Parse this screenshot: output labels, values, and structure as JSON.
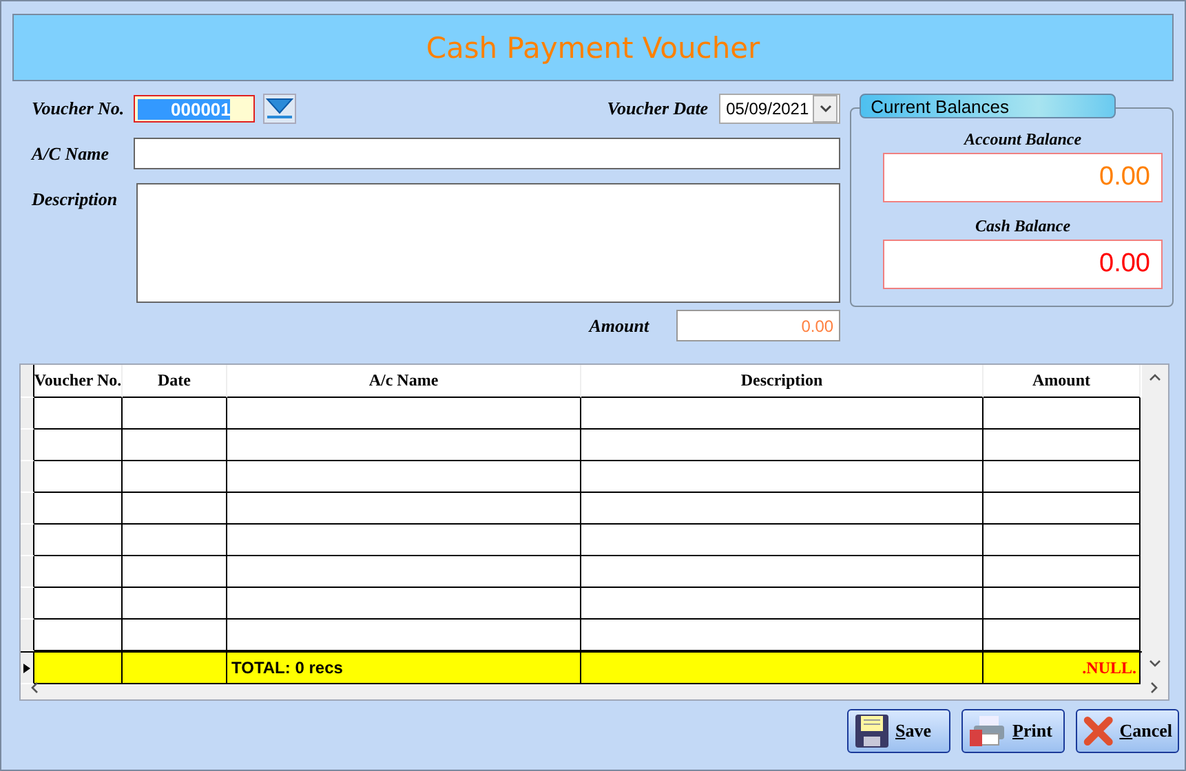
{
  "window": {
    "title": "Cash Payment Voucher"
  },
  "form": {
    "voucher_no_label": "Voucher No.",
    "voucher_no": "000001",
    "voucher_date_label": "Voucher Date",
    "voucher_date": "05/09/2021",
    "ac_name_label": "A/C Name",
    "description_label": "Description",
    "amount_label": "Amount",
    "amount": "0.00"
  },
  "balances": {
    "title": "Current Balances",
    "items": [
      {
        "label": "Account Balance",
        "value": "0.00",
        "color": "#ff8000"
      },
      {
        "label": "Cash Balance",
        "value": "0.00",
        "color": "#ff0000"
      }
    ]
  },
  "table": {
    "columns": [
      "Voucher No.",
      "Date",
      "A/c Name",
      "Description",
      "Amount"
    ],
    "total_row": {
      "label": "TOTAL: 0 recs",
      "amount": ".NULL."
    }
  },
  "buttons": [
    {
      "label": "Save",
      "kind": "save",
      "underline_first": true
    },
    {
      "label": "Print",
      "kind": "print",
      "underline_first": true
    },
    {
      "label": "Cancel",
      "kind": "cancel",
      "underline_first": true
    }
  ]
}
